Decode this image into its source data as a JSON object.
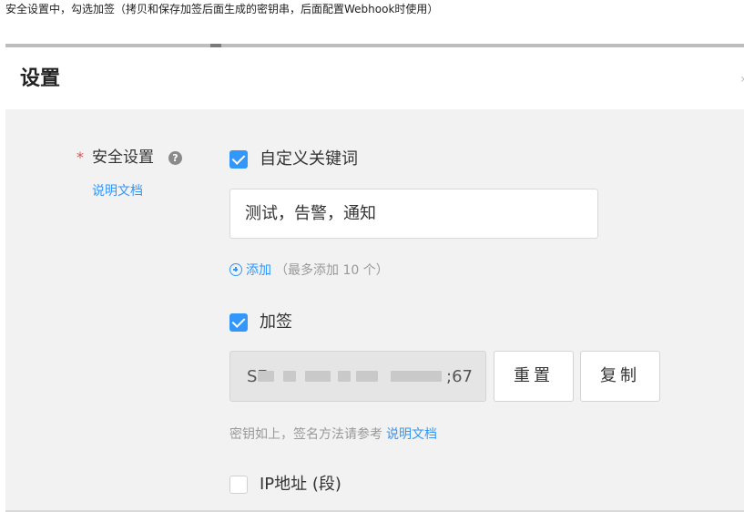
{
  "intro_text": "安全设置中，勾选加签（拷贝和保存加签后面生成的密钥串，后面配置Webhook时使用）",
  "dialog": {
    "title": "设置"
  },
  "security": {
    "required_mark": "*",
    "label": "安全设置",
    "help_glyph": "?",
    "doc_link": "说明文档",
    "custom_keywords": {
      "checked": true,
      "label": "自定义关键词",
      "value": "测试，告警，通知",
      "add_label": "添加",
      "add_note": "（最多添加 10 个）"
    },
    "signing": {
      "checked": true,
      "label": "加签",
      "secret_prefix": "SE",
      "secret_suffix": ";67",
      "reset_label": "重置",
      "copy_label": "复制",
      "hint": "密钥如上，签名方法请参考",
      "hint_link": "说明文档"
    },
    "ip": {
      "checked": false,
      "label": "IP地址 (段)"
    }
  },
  "colors": {
    "accent": "#3296fa",
    "required": "#e34d4d",
    "panel_bg": "#f2f2f2"
  }
}
